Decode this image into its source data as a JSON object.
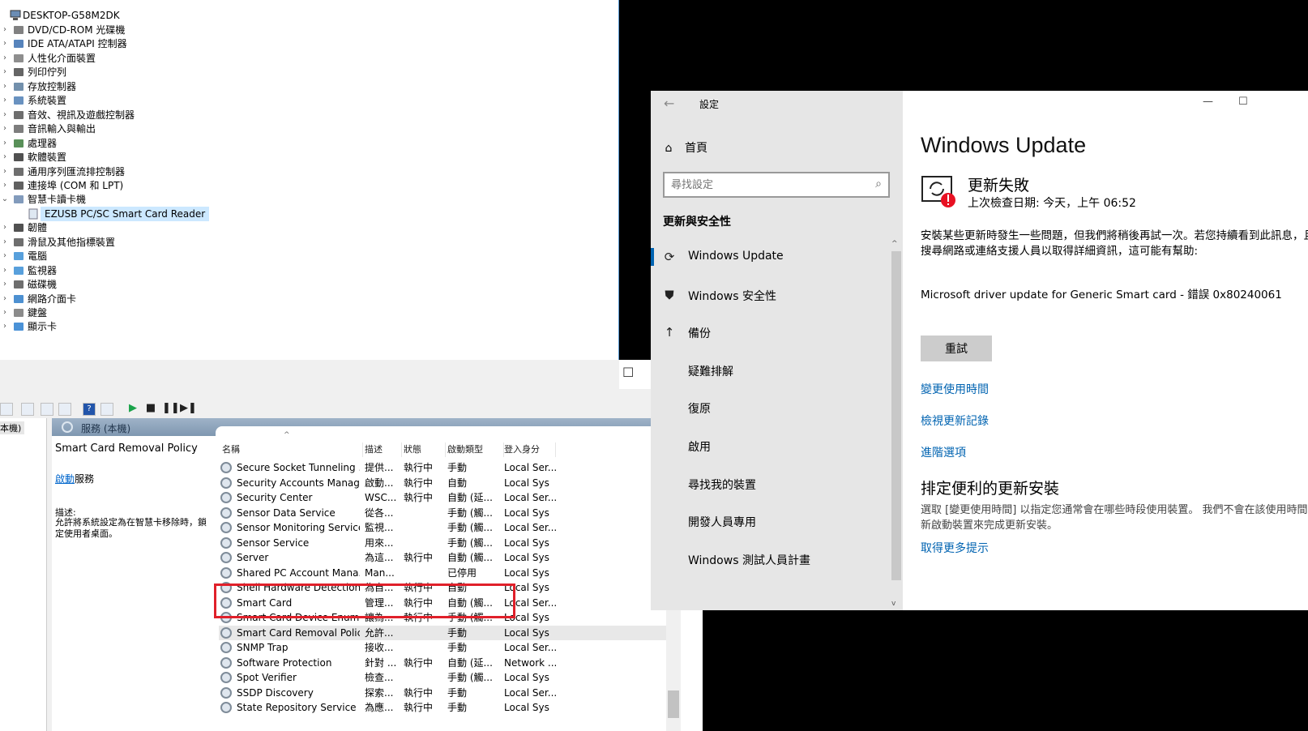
{
  "device_manager": {
    "root": "DESKTOP-G58M2DK",
    "categories": [
      {
        "label": "DVD/CD-ROM 光碟機",
        "icon": "dvd-drive-icon"
      },
      {
        "label": "IDE ATA/ATAPI 控制器",
        "icon": "ide-controller-icon"
      },
      {
        "label": "人性化介面裝置",
        "icon": "hid-icon"
      },
      {
        "label": "列印佇列",
        "icon": "printer-icon"
      },
      {
        "label": "存放控制器",
        "icon": "storage-controller-icon"
      },
      {
        "label": "系統裝置",
        "icon": "system-device-icon"
      },
      {
        "label": "音效、視訊及遊戲控制器",
        "icon": "sound-icon"
      },
      {
        "label": "音訊輸入與輸出",
        "icon": "audio-io-icon"
      },
      {
        "label": "處理器",
        "icon": "processor-icon"
      },
      {
        "label": "軟體裝置",
        "icon": "software-device-icon"
      },
      {
        "label": "通用序列匯流排控制器",
        "icon": "usb-icon"
      },
      {
        "label": "連接埠 (COM 和 LPT)",
        "icon": "port-icon"
      },
      {
        "label": "智慧卡讀卡機",
        "icon": "smart-card-reader-icon",
        "expanded": true,
        "child": "EZUSB PC/SC Smart Card Reader"
      },
      {
        "label": "韌體",
        "icon": "firmware-icon"
      },
      {
        "label": "滑鼠及其他指標裝置",
        "icon": "mouse-icon"
      },
      {
        "label": "電腦",
        "icon": "computer-icon"
      },
      {
        "label": "監視器",
        "icon": "monitor-icon"
      },
      {
        "label": "磁碟機",
        "icon": "disk-drive-icon"
      },
      {
        "label": "網路介面卡",
        "icon": "network-adapter-icon"
      },
      {
        "label": "鍵盤",
        "icon": "keyboard-icon"
      },
      {
        "label": "顯示卡",
        "icon": "display-adapter-icon"
      }
    ]
  },
  "services": {
    "left_node": "本機)",
    "pane_header": "服務 (本機)",
    "selected_service": "Smart Card Removal Policy",
    "start_link": "啟動",
    "start_suffix": "服務",
    "desc_label": "描述:",
    "desc_text": "允許將系統設定為在智慧卡移除時，鎖定使用者桌面。",
    "columns": [
      "名稱",
      "描述",
      "狀態",
      "啟動類型",
      "登入身分"
    ],
    "rows": [
      [
        "Secure Socket Tunneling ...",
        "提供...",
        "執行中",
        "手動",
        "Local Ser..."
      ],
      [
        "Security Accounts Manager",
        "啟動...",
        "執行中",
        "自動",
        "Local Sys"
      ],
      [
        "Security Center",
        "WSC...",
        "執行中",
        "自動 (延...",
        "Local Ser..."
      ],
      [
        "Sensor Data Service",
        "從各...",
        "",
        "手動 (觸...",
        "Local Sys"
      ],
      [
        "Sensor Monitoring Service",
        "監視...",
        "",
        "手動 (觸...",
        "Local Ser..."
      ],
      [
        "Sensor Service",
        "用來...",
        "",
        "手動 (觸...",
        "Local Sys"
      ],
      [
        "Server",
        "為這...",
        "執行中",
        "自動 (觸...",
        "Local Sys"
      ],
      [
        "Shared PC Account Mana...",
        "Man...",
        "",
        "已停用",
        "Local Sys"
      ],
      [
        "Shell Hardware Detection",
        "為自...",
        "執行中",
        "自動",
        "Local Sys"
      ],
      [
        "Smart Card",
        "管理...",
        "執行中",
        "自動 (觸...",
        "Local Ser..."
      ],
      [
        "Smart Card Device Enume...",
        "讓為...",
        "執行中",
        "手動 (觸...",
        "Local Sys"
      ],
      [
        "Smart Card Removal Policy",
        "允許...",
        "",
        "手動",
        "Local Sys"
      ],
      [
        "SNMP Trap",
        "接收...",
        "",
        "手動",
        "Local Ser..."
      ],
      [
        "Software Protection",
        "針對 ...",
        "執行中",
        "自動 (延...",
        "Network ..."
      ],
      [
        "Spot Verifier",
        "檢查...",
        "",
        "手動 (觸...",
        "Local Sys"
      ],
      [
        "SSDP Discovery",
        "探索...",
        "執行中",
        "手動",
        "Local Ser..."
      ],
      [
        "State Repository Service",
        "為應...",
        "執行中",
        "手動",
        "Local Sys"
      ]
    ]
  },
  "settings": {
    "app_title": "設定",
    "home": "首頁",
    "search_placeholder": "尋找設定",
    "section": "更新與安全性",
    "nav": [
      {
        "label": "Windows Update",
        "icon": "sync-icon"
      },
      {
        "label": "Windows 安全性",
        "icon": "shield-icon"
      },
      {
        "label": "備份",
        "icon": "backup-icon"
      },
      {
        "label": "疑難排解",
        "icon": "wrench-icon"
      },
      {
        "label": "復原",
        "icon": "recovery-icon"
      },
      {
        "label": "啟用",
        "icon": "activation-icon"
      },
      {
        "label": "尋找我的裝置",
        "icon": "find-device-icon"
      },
      {
        "label": "開發人員專用",
        "icon": "developer-icon"
      },
      {
        "label": "Windows 測試人員計畫",
        "icon": "insider-icon"
      }
    ],
    "title": "Windows Update",
    "status": "更新失敗",
    "last_check": "上次檢查日期: 今天，上午 06:52",
    "message": "安裝某些更新時發生一些問題，但我們將稍後再試一次。若您持續看到此訊息，且想要搜尋網路或連絡支援人員以取得詳細資訊，這可能有幫助:",
    "error": "Microsoft driver update for Generic Smart card - 錯誤 0x80240061",
    "retry": "重試",
    "links": [
      "變更使用時間",
      "檢視更新記錄",
      "進階選項"
    ],
    "schedule_title": "排定便利的更新安裝",
    "schedule_text": "選取 [變更使用時間] 以指定您通常會在哪些時段使用裝置。 我們不會在該使用時間自動重新啟動裝置來完成更新安裝。",
    "tips_link": "取得更多提示",
    "accent": "#0063b1"
  }
}
